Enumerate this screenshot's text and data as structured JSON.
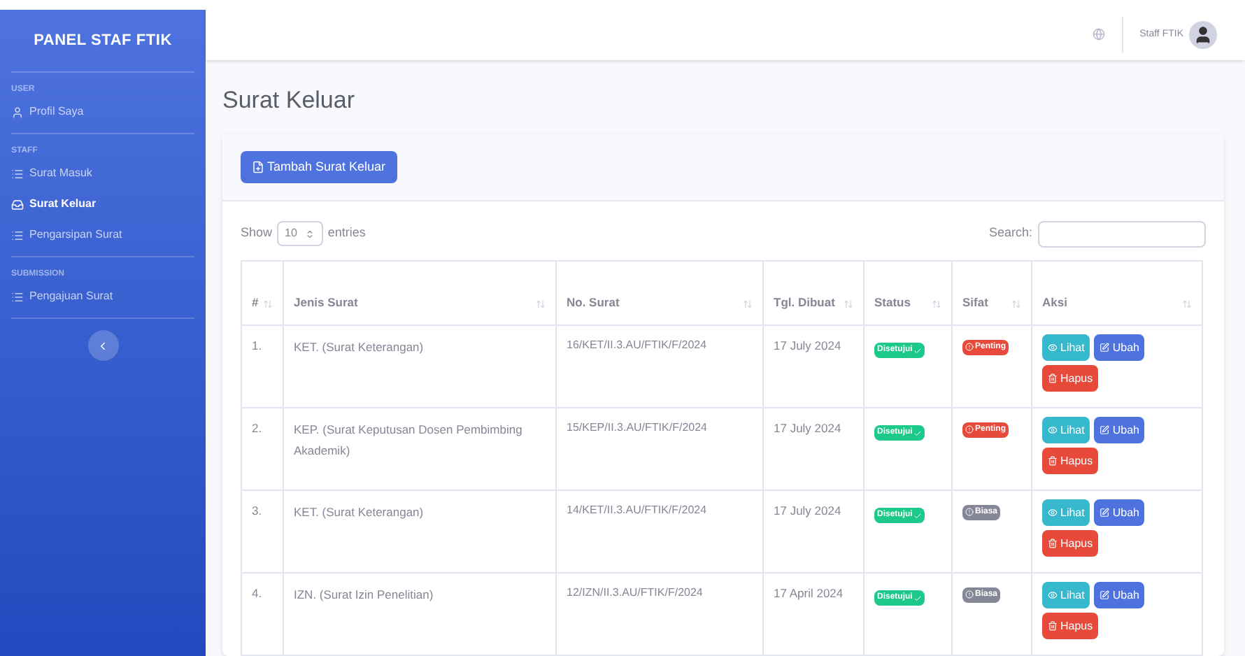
{
  "sidebar": {
    "brand": "PANEL STAF FTIK",
    "sections": [
      {
        "heading": "USER",
        "items": [
          {
            "label": "Profil Saya",
            "selected": false
          }
        ]
      },
      {
        "heading": "STAFF",
        "items": [
          {
            "label": "Surat Masuk",
            "selected": false
          },
          {
            "label": "Surat Keluar",
            "selected": true
          },
          {
            "label": "Pengarsipan Surat",
            "selected": false
          }
        ]
      },
      {
        "heading": "SUBMISSION",
        "items": [
          {
            "label": "Pengajuan Surat",
            "selected": false
          }
        ]
      }
    ]
  },
  "topbar": {
    "user_name": "Staff FTIK"
  },
  "page_title": "Surat Keluar",
  "add_button": "Tambah Surat Keluar",
  "length_control": {
    "prefix": "Show",
    "value": "10",
    "suffix": "entries"
  },
  "search": {
    "label": "Search:"
  },
  "table": {
    "columns": [
      "#",
      "Jenis Surat",
      "No. Surat",
      "Tgl. Dibuat",
      "Status",
      "Sifat",
      "Aksi"
    ],
    "rows": [
      {
        "no": "1.",
        "jenis": "KET. (Surat Keterangan)",
        "nomor": "16/KET/II.3.AU/FTIK/F/2024",
        "tanggal": "17 July 2024",
        "status": "Disetujui",
        "sifat": {
          "label": "Penting",
          "kind": "important"
        },
        "actions": [
          "Lihat",
          "Ubah",
          "Hapus"
        ]
      },
      {
        "no": "2.",
        "jenis": "KEP. (Surat Keputusan Dosen Pembimbing Akademik)",
        "nomor": "15/KEP/II.3.AU/FTIK/F/2024",
        "tanggal": "17 July 2024",
        "status": "Disetujui",
        "sifat": {
          "label": "Penting",
          "kind": "important"
        },
        "actions": [
          "Lihat",
          "Ubah",
          "Hapus"
        ]
      },
      {
        "no": "3.",
        "jenis": "KET. (Surat Keterangan)",
        "nomor": "14/KET/II.3.AU/FTIK/F/2024",
        "tanggal": "17 July 2024",
        "status": "Disetujui",
        "sifat": {
          "label": "Biasa",
          "kind": "normal"
        },
        "actions": [
          "Lihat",
          "Ubah",
          "Hapus"
        ]
      },
      {
        "no": "4.",
        "jenis": "IZN. (Surat Izin Penelitian)",
        "nomor": "12/IZN/II.3.AU/FTIK/F/2024",
        "tanggal": "17 April 2024",
        "status": "Disetujui",
        "sifat": {
          "label": "Biasa",
          "kind": "normal"
        },
        "actions": [
          "Lihat",
          "Ubah",
          "Hapus"
        ]
      }
    ]
  }
}
